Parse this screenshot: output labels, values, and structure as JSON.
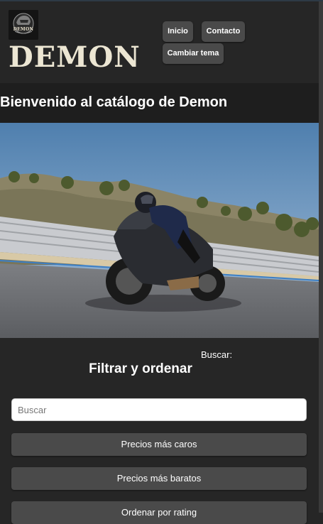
{
  "logo": {
    "badge_text": "DEMON",
    "wordmark": "DEMON",
    "icon": "motorcycle-helmet-logo-icon"
  },
  "nav": {
    "items": [
      {
        "label": "Inicio"
      },
      {
        "label": "Contacto"
      },
      {
        "label": "Cambiar tema"
      }
    ]
  },
  "welcome": {
    "title": "Bienvenido al catálogo de Demon"
  },
  "hero": {
    "image": "motorcycle-rider-on-track-image"
  },
  "filter": {
    "search_label": "Buscar:",
    "title": "Filtrar y ordenar",
    "search_placeholder": "Buscar",
    "sort_buttons": [
      {
        "label": "Precios más caros"
      },
      {
        "label": "Precios más baratos"
      },
      {
        "label": "Ordenar por rating"
      }
    ]
  },
  "colors": {
    "background": "#262626",
    "header_band": "#1e1e1e",
    "button": "#4a4a4a",
    "wordmark": "#ece6d3"
  }
}
